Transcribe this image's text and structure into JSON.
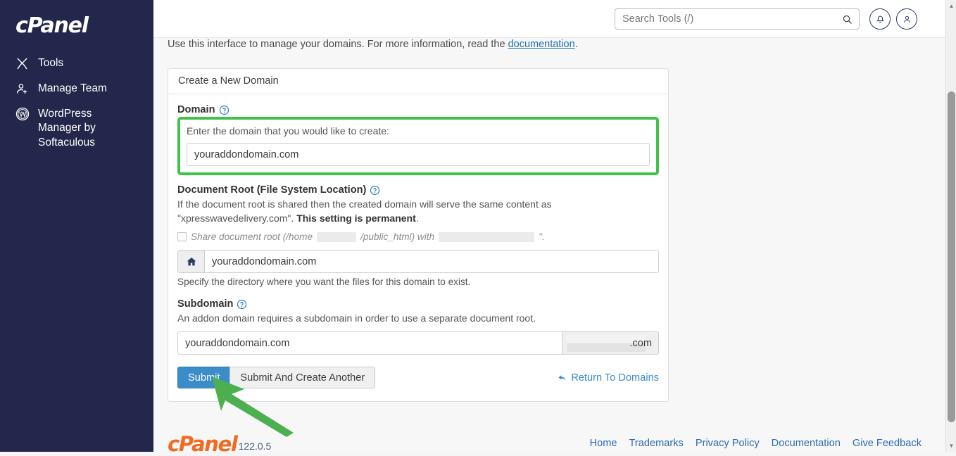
{
  "sidebar": {
    "brand": "cPanel",
    "items": [
      {
        "label": "Tools",
        "icon": "tools-icon"
      },
      {
        "label": "Manage Team",
        "icon": "manage-team-icon"
      },
      {
        "label": "WordPress Manager by Softaculous",
        "icon": "wordpress-icon"
      }
    ]
  },
  "header": {
    "search": {
      "placeholder": "Search Tools (/)",
      "value": ""
    },
    "notifications_icon": "bell-icon",
    "user_icon": "user-icon"
  },
  "main": {
    "intro_prefix": "Use this interface to manage your domains. For more information, read the ",
    "intro_link": "documentation",
    "intro_suffix": "."
  },
  "card": {
    "title": "Create a New Domain",
    "domain": {
      "label": "Domain",
      "help_icon": "help-circle-icon",
      "hint": "Enter the domain that you would like to create:",
      "value": "youraddondomain.com",
      "highlighted": true,
      "highlight_color": "#3fc24a"
    },
    "document_root": {
      "label": "Document Root (File System Location)",
      "help_icon": "help-circle-icon",
      "hint_part1": "If the document root is shared then the created domain will serve the same content as \"xpresswavedelivery.com\". ",
      "hint_bold": "This setting is permanent",
      "hint_part2": ".",
      "share_checkbox_checked": false,
      "share_text_part1": "Share document root (/home",
      "share_text_part2": "/public_html) with",
      "share_text_part3": "\".",
      "home_icon": "home-icon",
      "value": "youraddondomain.com",
      "sub_hint": "Specify the directory where you want the files for this domain to exist."
    },
    "subdomain": {
      "label": "Subdomain",
      "help_icon": "help-circle-icon",
      "hint": "An addon domain requires a subdomain in order to use a separate document root.",
      "value": "youraddondomain.com",
      "suffix_tld": ".com"
    },
    "buttons": {
      "submit": "Submit",
      "submit_and_create_another": "Submit And Create Another",
      "return_link": "Return To Domains",
      "return_icon": "back-arrow-icon"
    }
  },
  "annotation": {
    "arrow_icon": "green-arrow-icon",
    "arrow_color": "#4caf50"
  },
  "footer": {
    "brand": "cPanel",
    "version": "122.0.5",
    "links": [
      "Home",
      "Trademarks",
      "Privacy Policy",
      "Documentation",
      "Give Feedback"
    ]
  },
  "scrollbar": {
    "up_icon": "scroll-up-icon",
    "down_icon": "scroll-down-icon"
  }
}
